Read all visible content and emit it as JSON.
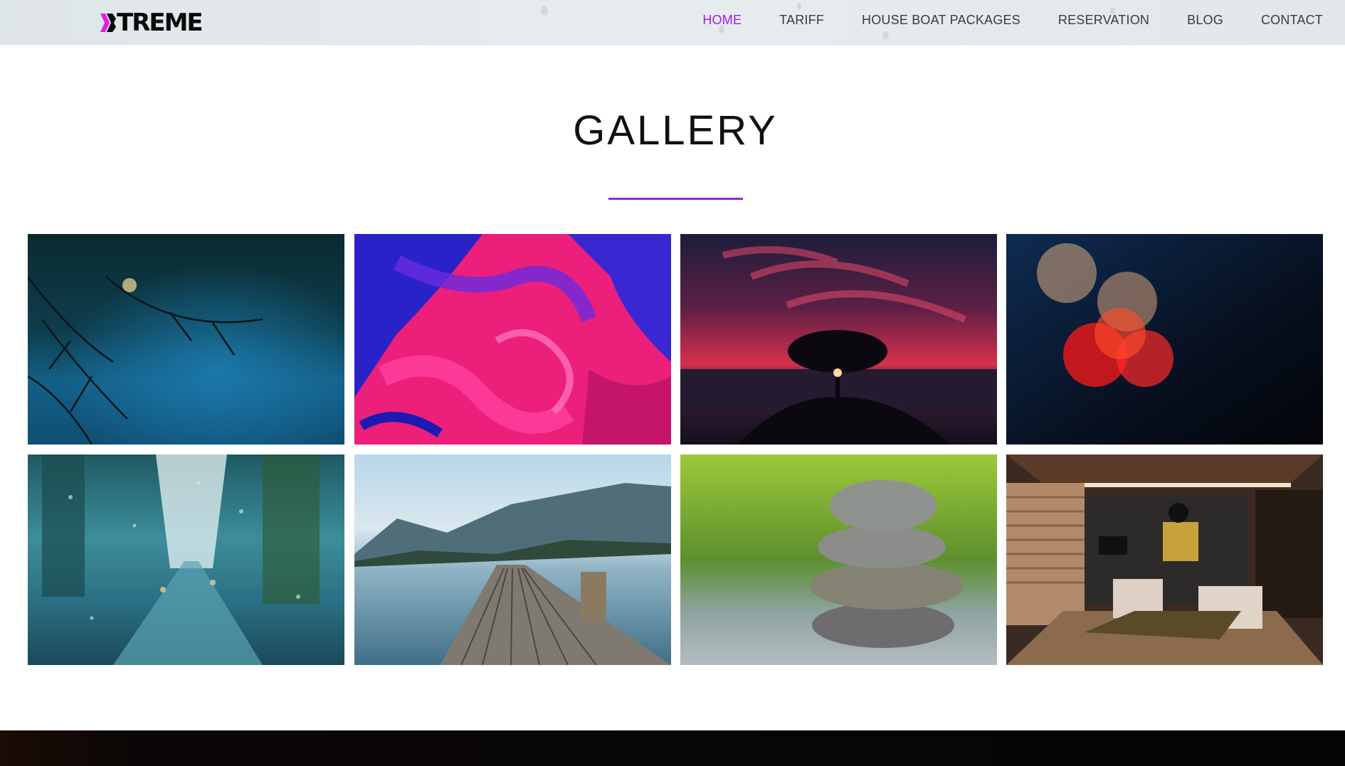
{
  "header": {
    "logo_text": "TREME",
    "logo_mark_color": "#e11ee6",
    "nav": [
      {
        "label": "HOME",
        "active": true
      },
      {
        "label": "TARIFF",
        "active": false
      },
      {
        "label": "HOUSE BOAT PACKAGES",
        "active": false
      },
      {
        "label": "RESERVATION",
        "active": false
      },
      {
        "label": "BLOG",
        "active": false
      },
      {
        "label": "CONTACT",
        "active": false
      }
    ]
  },
  "gallery": {
    "title": "GALLERY",
    "accent_color": "#8a2be2",
    "images": [
      {
        "name": "blurred-road-branches"
      },
      {
        "name": "abstract-pink-paint"
      },
      {
        "name": "sunset-tree"
      },
      {
        "name": "bokeh-lights"
      },
      {
        "name": "rainy-city-street"
      },
      {
        "name": "lake-pier-mountains"
      },
      {
        "name": "stacked-stones"
      },
      {
        "name": "living-room-interior"
      }
    ]
  }
}
